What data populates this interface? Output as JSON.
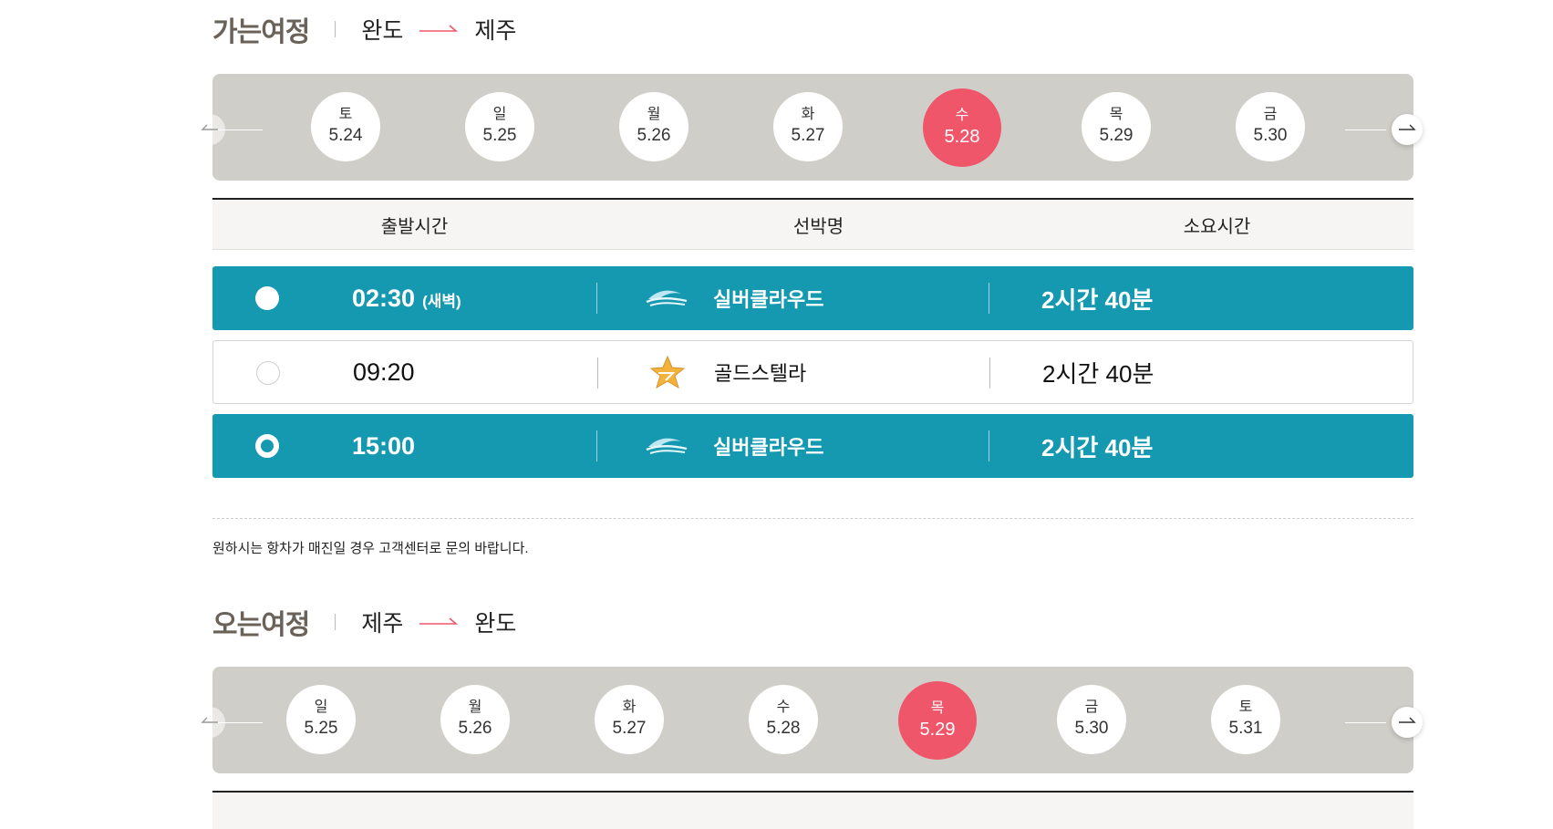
{
  "outbound": {
    "title": "가는여정",
    "from": "완도",
    "to": "제주",
    "dates": [
      {
        "dow": "토",
        "md": "5.24"
      },
      {
        "dow": "일",
        "md": "5.25"
      },
      {
        "dow": "월",
        "md": "5.26"
      },
      {
        "dow": "화",
        "md": "5.27"
      },
      {
        "dow": "수",
        "md": "5.28"
      },
      {
        "dow": "목",
        "md": "5.29"
      },
      {
        "dow": "금",
        "md": "5.30"
      }
    ],
    "selected_date": "5.28",
    "table_headers": [
      "출발시간",
      "선박명",
      "소요시간"
    ],
    "rows": [
      {
        "time": "02:30",
        "time_note": "(새벽)",
        "ship": "실버클라우드",
        "ship_icon": "wave-logo-icon",
        "duration": "2시간 40분",
        "state": "highlighted"
      },
      {
        "time": "09:20",
        "time_note": "",
        "ship": "골드스텔라",
        "ship_icon": "gold-star-logo-icon",
        "duration": "2시간 40분",
        "state": "normal"
      },
      {
        "time": "15:00",
        "time_note": "",
        "ship": "실버클라우드",
        "ship_icon": "wave-logo-icon",
        "duration": "2시간 40분",
        "state": "selected"
      }
    ],
    "notice": "원하시는 항차가 매진일 경우 고객센터로 문의 바랍니다."
  },
  "return": {
    "title": "오는여정",
    "from": "제주",
    "to": "완도",
    "dates": [
      {
        "dow": "일",
        "md": "5.25"
      },
      {
        "dow": "월",
        "md": "5.26"
      },
      {
        "dow": "화",
        "md": "5.27"
      },
      {
        "dow": "수",
        "md": "5.28"
      },
      {
        "dow": "목",
        "md": "5.29"
      },
      {
        "dow": "금",
        "md": "5.30"
      },
      {
        "dow": "토",
        "md": "5.31"
      }
    ],
    "selected_date": "5.29"
  },
  "colors": {
    "accent_red": "#f0566a",
    "accent_teal": "#1599b0",
    "strip_gray": "#d0cec8",
    "title_brown": "#6a6259"
  }
}
